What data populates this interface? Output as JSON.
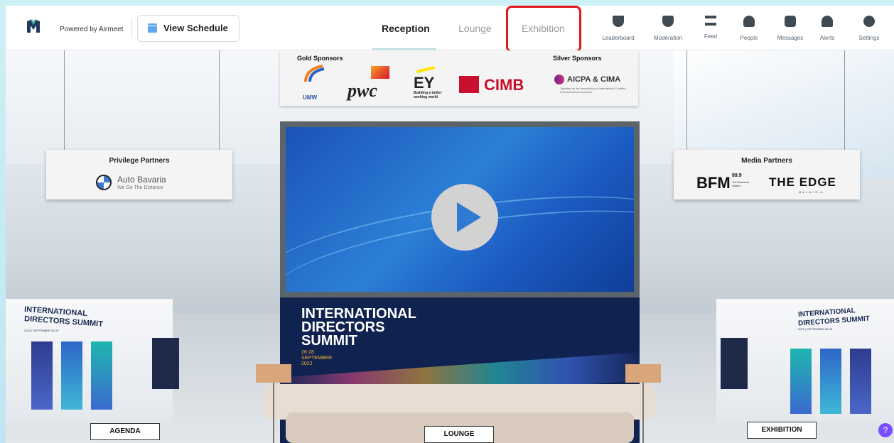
{
  "header": {
    "powered_by": "Powered by Airmeet",
    "view_schedule": "View Schedule",
    "tabs": [
      {
        "label": "Reception",
        "active": true
      },
      {
        "label": "Lounge",
        "active": false
      },
      {
        "label": "Exhibition",
        "active": false,
        "highlighted": true
      }
    ],
    "nav": [
      {
        "label": "Leaderboard",
        "icon": "trophy-icon"
      },
      {
        "label": "Moderation",
        "icon": "shield-icon"
      },
      {
        "label": "Feed",
        "icon": "feed-icon"
      },
      {
        "label": "People",
        "icon": "people-icon"
      },
      {
        "label": "Messages",
        "icon": "messages-icon"
      },
      {
        "label": "Alerts",
        "icon": "bell-icon"
      },
      {
        "label": "Settings",
        "icon": "gear-icon"
      }
    ]
  },
  "hall": {
    "gold_sponsors_title": "Gold Sponsors",
    "silver_sponsors_title": "Silver Sponsors",
    "gold_sponsors": [
      {
        "name": "UMW"
      },
      {
        "name": "pwc"
      },
      {
        "name": "EY",
        "tagline": "Building a better working world"
      },
      {
        "name": "CIMB"
      }
    ],
    "silver_sponsor": {
      "name": "AICPA & CIMA",
      "tagline": "Together as the Association of International Certified Professional Accountants"
    },
    "privilege_partners": {
      "title": "Privilege Partners",
      "name": "Auto Bavaria",
      "tagline": "We Go The Distance"
    },
    "media_partners": {
      "title": "Media Partners",
      "bfm": "BFM",
      "bfm_freq": "89.9",
      "bfm_tag": "The Business Station",
      "edge": "THE EDGE",
      "edge_sub": "MALAYSIA"
    },
    "summit": {
      "line1": "INTERNATIONAL",
      "line2": "DIRECTORS",
      "line3": "SUMMIT",
      "dates_line1": "26-28",
      "dates_line2": "SEPTEMBER",
      "dates_line3": "2022"
    },
    "booth_left_line1": "INTERNATIONAL",
    "booth_left_line2": "DIRECTORS SUMMIT",
    "booth_left_line3": "2022 | SEPTEMBER 26-28",
    "booth_right_line1": "INTERNATIONAL",
    "booth_right_line2": "DIRECTORS SUMMIT",
    "booth_right_line3": "2022 | SEPTEMBER 26-28",
    "labels": {
      "agenda": "AGENDA",
      "lounge": "LOUNGE",
      "exhibition": "EXHIBITION"
    }
  },
  "help": {
    "icon": "help-icon",
    "glyph": "?"
  },
  "colors": {
    "highlight": "#e21818",
    "screen_blue": "#1b53b8",
    "summit_navy": "#10224f",
    "help_purple": "#7a4dff"
  }
}
